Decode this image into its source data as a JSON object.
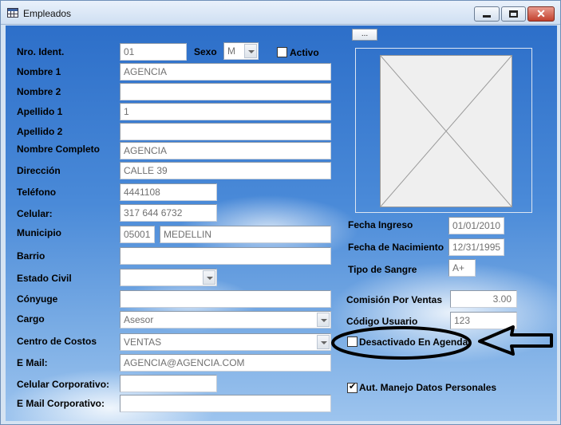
{
  "window": {
    "title": "Empleados",
    "icon": "table-icon",
    "controls": [
      "minimize-icon",
      "maximize-icon",
      "close-icon"
    ],
    "close_glyph": "✕"
  },
  "photo_button_label": "...",
  "form": {
    "nro_ident": {
      "label": "Nro. Ident.",
      "value": "01"
    },
    "sexo": {
      "label": "Sexo",
      "value": "M"
    },
    "activo": {
      "label": "Activo",
      "checked": false
    },
    "nombre1": {
      "label": "Nombre 1",
      "value": "AGENCIA"
    },
    "nombre2": {
      "label": "Nombre 2",
      "value": ""
    },
    "apellido1": {
      "label": "Apellido 1",
      "value": "1"
    },
    "apellido2": {
      "label": "Apellido 2",
      "value": ""
    },
    "nombre_completo": {
      "label": "Nombre Completo",
      "value": "AGENCIA"
    },
    "direccion": {
      "label": "Dirección",
      "value": "CALLE 39"
    },
    "telefono": {
      "label": "Teléfono",
      "value": "4441108"
    },
    "celular": {
      "label": "Celular:",
      "value": "317 644 6732"
    },
    "municipio": {
      "label": "Municipio",
      "code": "05001",
      "name": "MEDELLIN"
    },
    "barrio": {
      "label": "Barrio",
      "value": ""
    },
    "estado_civil": {
      "label": "Estado Civil",
      "value": ""
    },
    "conyuge": {
      "label": "Cónyuge",
      "value": ""
    },
    "cargo": {
      "label": "Cargo",
      "value": "Asesor"
    },
    "centro_costos": {
      "label": "Centro de Costos",
      "value": "VENTAS"
    },
    "email": {
      "label": "E Mail:",
      "value": "AGENCIA@AGENCIA.COM"
    },
    "celular_corp": {
      "label": "Celular Corporativo:",
      "value": ""
    },
    "email_corp": {
      "label": "E Mail Corporativo:",
      "value": ""
    },
    "fecha_ingreso": {
      "label": "Fecha Ingreso",
      "value": "01/01/2010"
    },
    "fecha_nacimiento": {
      "label": "Fecha de Nacimiento",
      "value": "12/31/1995"
    },
    "tipo_sangre": {
      "label": "Tipo de Sangre",
      "value": "A+"
    },
    "comision": {
      "label": "Comisión Por Ventas",
      "value": "3.00"
    },
    "codigo_usuario": {
      "label": "Código Usuario",
      "value": "123"
    },
    "desactivado_agenda": {
      "label": "Desactivado En Agenda",
      "checked": false
    },
    "aut_datos": {
      "label": "Aut. Manejo Datos Personales",
      "checked": true
    }
  },
  "colors": {
    "annotation": "#000000",
    "background_top": "#2d6fc9",
    "background_bottom": "#9dc4ee"
  }
}
